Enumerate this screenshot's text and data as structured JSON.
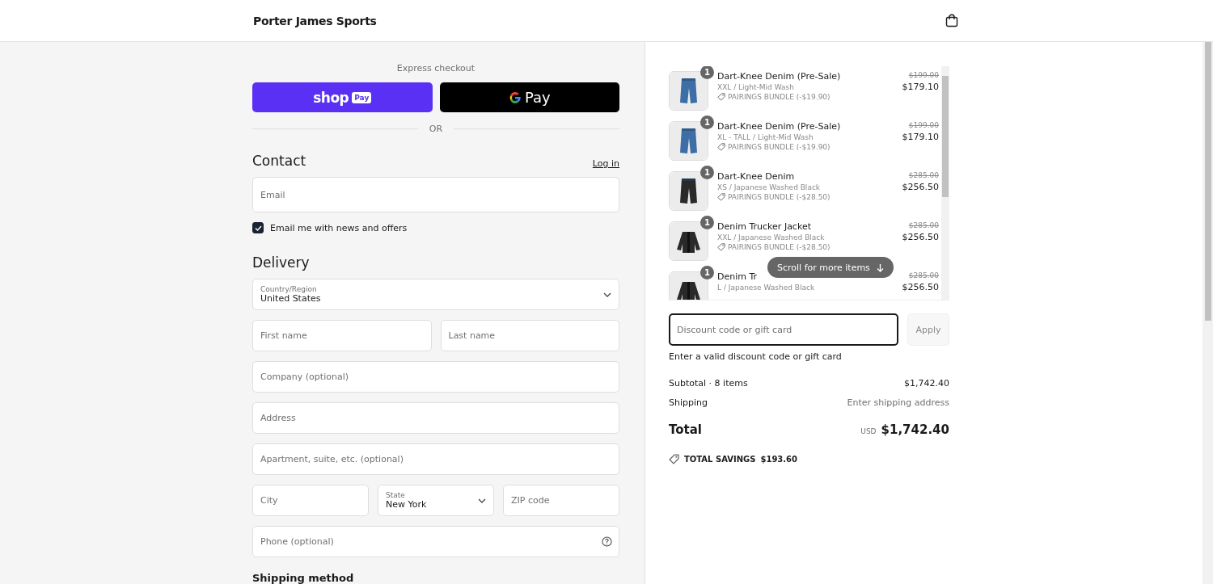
{
  "header": {
    "store_name": "Porter James Sports"
  },
  "express": {
    "title": "Express checkout",
    "buttons": [
      {
        "kind": "shop",
        "label": "shop",
        "badge": "Pay"
      },
      {
        "kind": "gpay",
        "label": "Pay"
      }
    ],
    "divider": "OR"
  },
  "contact": {
    "title": "Contact",
    "login": "Log in",
    "email": {
      "placeholder": "Email"
    },
    "newsletter": {
      "label": "Email me with news and offers",
      "checked": true
    }
  },
  "delivery": {
    "title": "Delivery",
    "rows": [
      [
        {
          "kind": "select",
          "label": "Country/Region",
          "value": "United States"
        }
      ],
      [
        {
          "kind": "input",
          "placeholder": "First name"
        },
        {
          "kind": "input",
          "placeholder": "Last name"
        }
      ],
      [
        {
          "kind": "input",
          "placeholder": "Company (optional)"
        }
      ],
      [
        {
          "kind": "input",
          "placeholder": "Address"
        }
      ],
      [
        {
          "kind": "input",
          "placeholder": "Apartment, suite, etc. (optional)"
        }
      ],
      [
        {
          "kind": "input",
          "placeholder": "City"
        },
        {
          "kind": "select",
          "label": "State",
          "value": "New York"
        },
        {
          "kind": "input",
          "placeholder": "ZIP code"
        }
      ],
      [
        {
          "kind": "help",
          "placeholder": "Phone (optional)"
        }
      ]
    ]
  },
  "shipping_method": {
    "title": "Shipping method"
  },
  "cart": {
    "items": [
      {
        "quantity": "1",
        "name": "Dart-Knee Denim (Pre-Sale)",
        "variant": "XXL / Light-Mid Wash",
        "discount": "PAIRINGS BUNDLE (-$19.90)",
        "original_price": "$199.00",
        "price": "$179.10"
      },
      {
        "quantity": "1",
        "name": "Dart-Knee Denim (Pre-Sale)",
        "variant": "XL - TALL / Light-Mid Wash",
        "discount": "PAIRINGS BUNDLE (-$19.90)",
        "original_price": "$199.00",
        "price": "$179.10"
      },
      {
        "quantity": "1",
        "name": "Dart-Knee Denim",
        "variant": "XS / Japanese Washed Black",
        "discount": "PAIRINGS BUNDLE (-$28.50)",
        "original_price": "$285.00",
        "price": "$256.50"
      },
      {
        "quantity": "1",
        "name": "Denim Trucker Jacket",
        "variant": "XXL / Japanese Washed Black",
        "discount": "PAIRINGS BUNDLE (-$28.50)",
        "original_price": "$285.00",
        "price": "$256.50"
      },
      {
        "quantity": "1",
        "name": "Denim Tr",
        "variant": "L / Japanese Washed Black",
        "original_price": "$285.00",
        "price": "$256.50"
      }
    ],
    "scroll_hint": "Scroll for more items"
  },
  "discount": {
    "placeholder": "Discount code or gift card",
    "apply": "Apply",
    "message": "Enter a valid discount code or gift card"
  },
  "summary": {
    "subtotal_label": "Subtotal · 8 items",
    "subtotal": "$1,742.40",
    "shipping_label": "Shipping",
    "shipping": "Enter shipping address",
    "total_label": "Total",
    "currency": "USD",
    "total": "$1,742.40",
    "savings_label": "TOTAL SAVINGS",
    "savings": "$193.60"
  }
}
